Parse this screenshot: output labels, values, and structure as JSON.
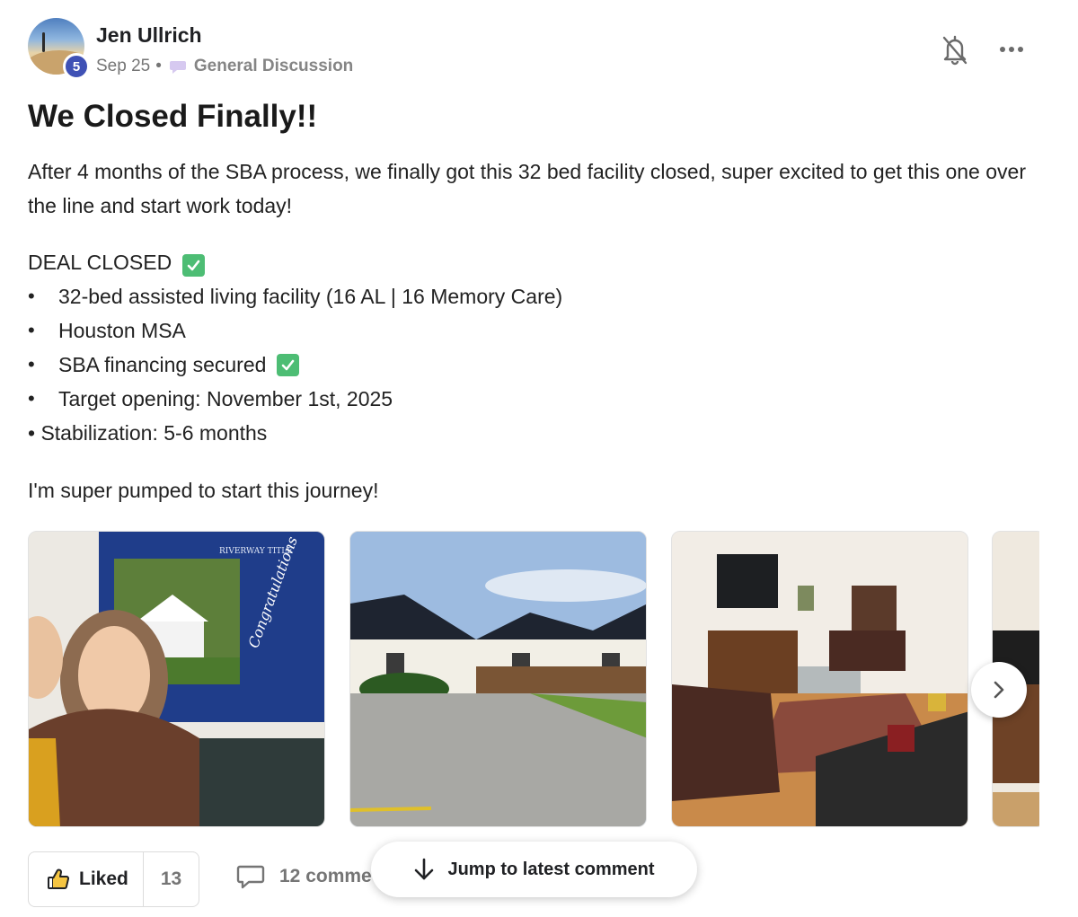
{
  "post": {
    "author": "Jen Ullrich",
    "level": "5",
    "date": "Sep 25",
    "separator": "•",
    "category": "General Discussion",
    "title": "We Closed Finally!!",
    "intro": "After 4 months of the SBA process, we finally got this 32 bed facility closed, super excited to get this one over the line and start work today!",
    "deal_heading": "DEAL CLOSED",
    "bullets": [
      "32-bed assisted living facility (16 AL | 16 Memory Care)",
      "Houston MSA",
      "SBA financing secured",
      "Target opening: November 1st, 2025"
    ],
    "stabilization": "• Stabilization: 5-6 months",
    "closing_line": "I'm super pumped to start this journey!",
    "photo_sign_text": "RIVERWAY TITLE",
    "photo_sign_script": "Congratulations"
  },
  "footer": {
    "like_label": "Liked",
    "like_count": "13",
    "comments_label": "12 comme",
    "jump_label": "Jump to latest comment"
  },
  "colors": {
    "accent_badge": "#3f51b5",
    "check_green": "#4dbd74",
    "muted_text": "#757575"
  },
  "icons": [
    "bell-off-icon",
    "more-icon",
    "comment-bubble-icon",
    "check-icon",
    "thumbs-up-icon",
    "chevron-right-icon",
    "arrow-down-icon"
  ]
}
